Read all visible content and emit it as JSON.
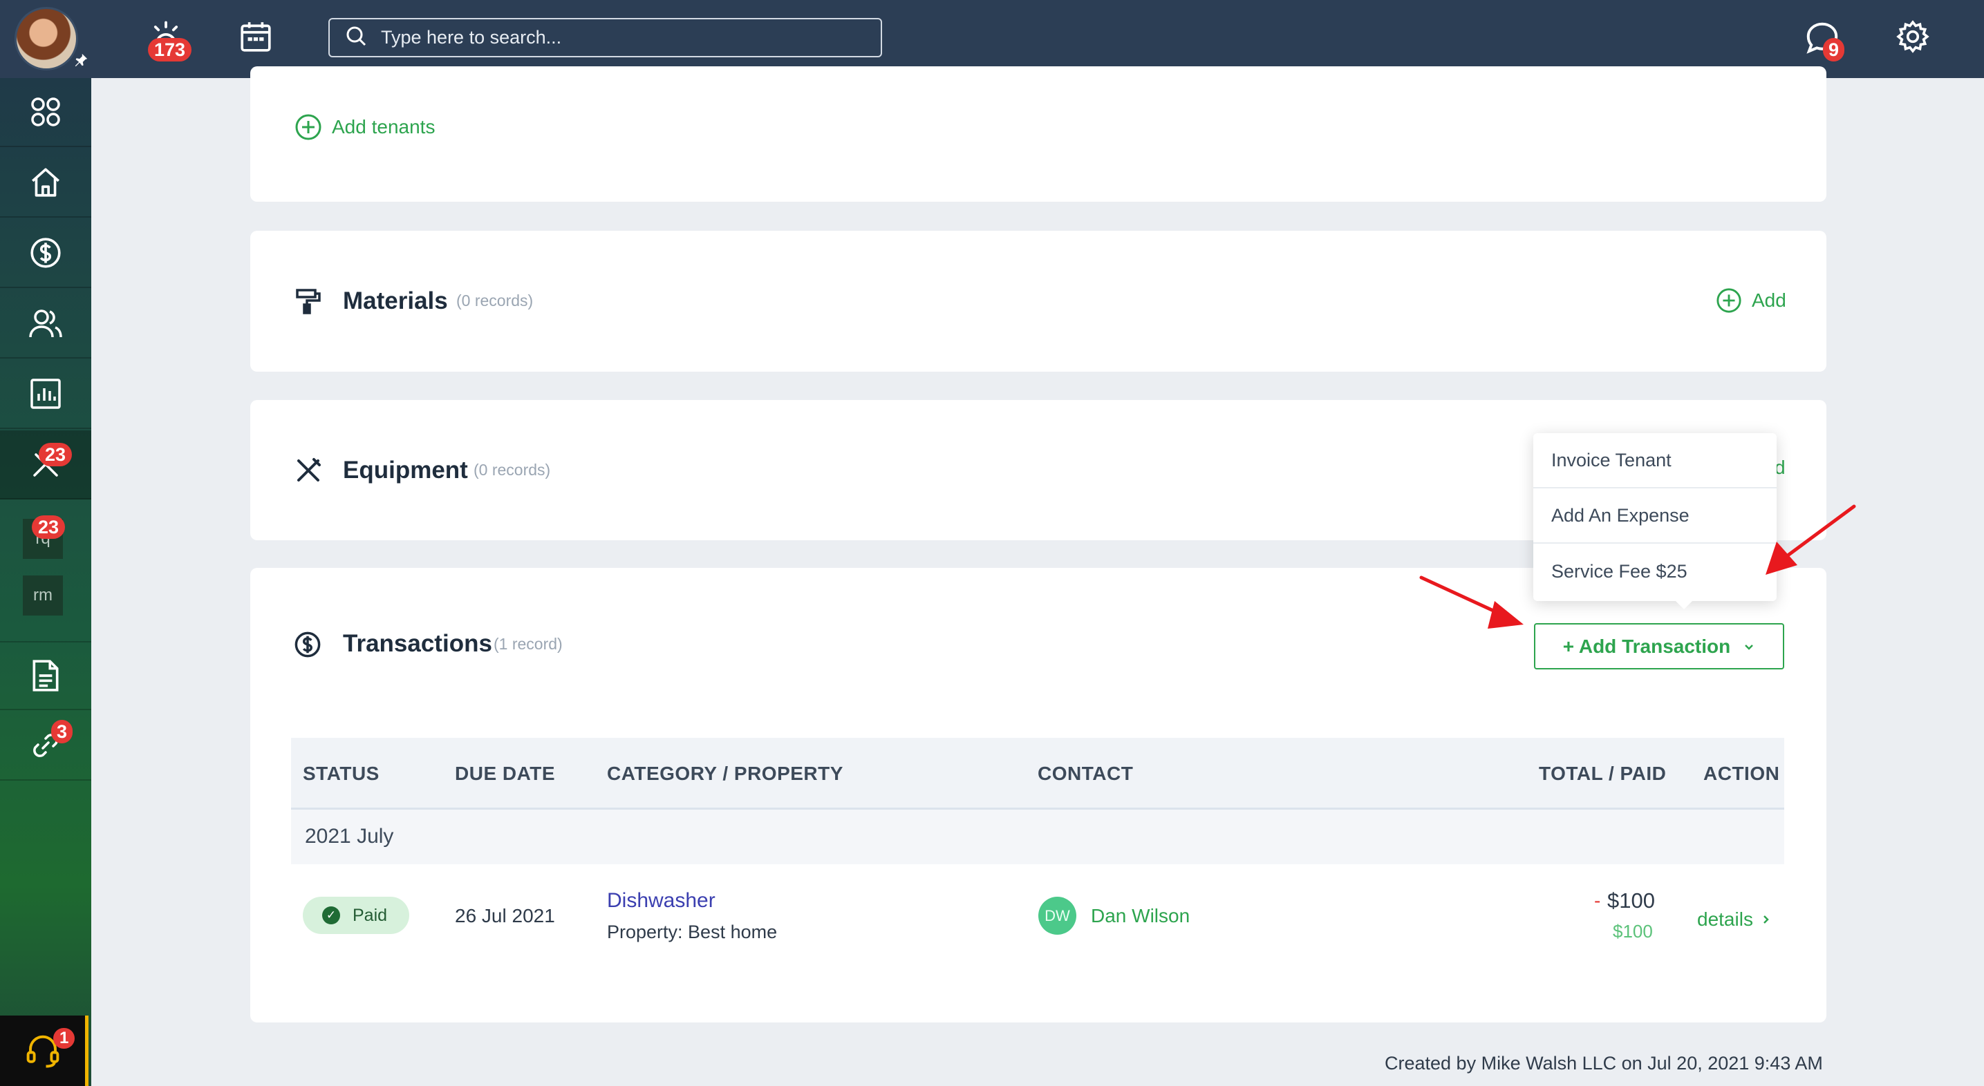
{
  "topbar": {
    "alerts_badge": "173",
    "messages_badge": "9",
    "search_placeholder": "Type here to search..."
  },
  "sidebar": {
    "maintenance_badge": "23",
    "requests_badge": "23",
    "requests_label": "rq",
    "rm_label": "rm",
    "links_badge": "3",
    "support_badge": "1"
  },
  "tenants": {
    "add_label": "Add tenants"
  },
  "materials": {
    "title": "Materials",
    "count": "(0 records)",
    "add_label": "Add"
  },
  "equipment": {
    "title": "Equipment",
    "count": "(0 records)",
    "add_partial": "d"
  },
  "dropdown": {
    "items": [
      "Invoice Tenant",
      "Add An Expense",
      "Service Fee $25"
    ]
  },
  "transactions": {
    "title": "Transactions",
    "count": "(1 record)",
    "add_button": "+ Add Transaction",
    "columns": [
      "STATUS",
      "DUE DATE",
      "CATEGORY / PROPERTY",
      "CONTACT",
      "TOTAL / PAID",
      "ACTION"
    ],
    "group": "2021 July",
    "rows": [
      {
        "status": "Paid",
        "due_date": "26 Jul 2021",
        "category": "Dishwasher",
        "property": "Property: Best home",
        "contact_initials": "DW",
        "contact_name": "Dan Wilson",
        "total_sign": "-",
        "total": "$100",
        "paid": "$100",
        "action": "details"
      }
    ]
  },
  "footer": {
    "created_by": "Created by Mike Walsh LLC on Jul 20, 2021 9:43 AM"
  },
  "colors": {
    "topbar": "#2c3e55",
    "accent_green": "#2da44e",
    "badge_red": "#e53935",
    "annotation_arrow": "#e8191e"
  }
}
